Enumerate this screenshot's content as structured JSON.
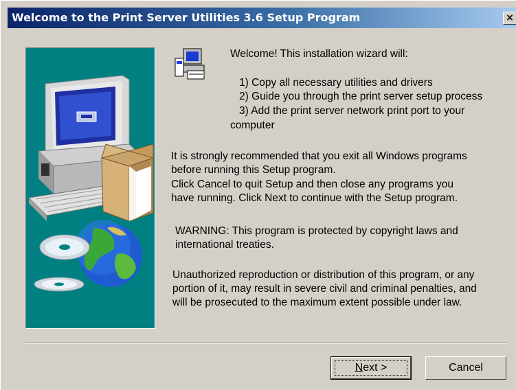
{
  "window": {
    "title": "Welcome to the Print Server Utilities 3.6 Setup Program",
    "close_label": "×"
  },
  "content": {
    "intro": "Welcome! This installation wizard will:",
    "steps": [
      "1) Copy all necessary utilities and drivers",
      "2) Guide you through the print server setup process",
      "3) Add the print server network print port to your",
      "computer"
    ],
    "recommend_lines": [
      "It is strongly recommended that you exit all Windows programs",
      "before running this Setup program.",
      "Click Cancel to quit Setup and then close any programs you",
      "have running.  Click Next to continue with the Setup program."
    ],
    "warning_lines": [
      "WARNING: This program is protected by copyright laws and",
      "international treaties."
    ],
    "legal_lines": [
      "Unauthorized reproduction or distribution of this program, or any",
      "portion of it, may result in severe civil and criminal penalties, and",
      "will be prosecuted to the maximum extent possible under law."
    ]
  },
  "buttons": {
    "next": "Next >",
    "cancel": "Cancel"
  },
  "colors": {
    "titlebar_start": "#0a246a",
    "titlebar_end": "#a6caf0",
    "panel_bg": "#008080",
    "dialog_bg": "#d4d0c8"
  },
  "icons": {
    "setup_icon": "computer-setup-icon",
    "illustration": "computer-globe-cd-illustration"
  }
}
